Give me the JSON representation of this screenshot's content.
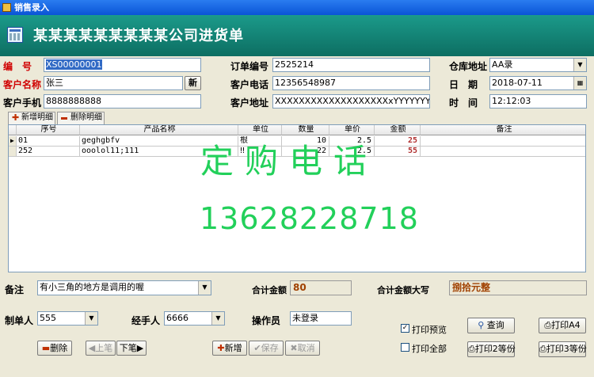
{
  "window": {
    "title": "销售录入"
  },
  "header": {
    "title": "某某某某某某某某某公司进货单"
  },
  "form": {
    "id_label": "编　号",
    "id_value": "XS00000001",
    "order_no_label": "订单编号",
    "order_no_value": "2525214",
    "warehouse_label": "仓库地址",
    "warehouse_value": "AA录",
    "customer_name_label": "客户名称",
    "customer_name_value": "张三",
    "new_customer_label": "新",
    "customer_phone_label": "客户电话",
    "customer_phone_value": "12356548987",
    "date_label": "日　期",
    "date_value": "2018-07-11",
    "customer_mobile_label": "客户手机",
    "customer_mobile_value": "8888888888",
    "customer_address_label": "客户地址",
    "customer_address_value": "XXXXXXXXXXXXXXXXXXXxYYYYYYYY",
    "time_label": "时　间",
    "time_value": "12:12:03"
  },
  "tabs": {
    "add_label": "新增明细",
    "delete_label": "删除明细"
  },
  "grid": {
    "columns": [
      "序号",
      "产品名称",
      "单位",
      "数量",
      "单价",
      "金额",
      "备注"
    ],
    "rows": [
      {
        "seq": "01",
        "name": "geghgbfv",
        "unit": "根",
        "qty": "10",
        "price": "2.5",
        "amount": "25",
        "note": ""
      },
      {
        "seq": "252",
        "name": "ooolol11;111",
        "unit": "‼",
        "qty": "22",
        "price": "2.5",
        "amount": "55",
        "note": ""
      }
    ]
  },
  "watermark": {
    "line1": "定购电话",
    "line2": "13628228718"
  },
  "footer": {
    "remark_label": "备注",
    "remark_value": "有小三角的地方是调用的喔",
    "total_label": "合计金额",
    "total_value": "80",
    "total_upper_label": "合计金额大写",
    "total_upper_value": "捌拾元整",
    "maker_label": "制单人",
    "maker_value": "555",
    "handler_label": "经手人",
    "handler_value": "6666",
    "operator_label": "操作员",
    "operator_value": "未登录",
    "print_preview_label": "打印预览",
    "print_all_label": "打印全部",
    "query_label": "查询",
    "print_a4_label": "打印A4",
    "print_half_label": "打印2等份",
    "print_third_label": "打印3等份",
    "delete_label": "删除",
    "prev_label": "上笔",
    "next_label": "下笔",
    "add_label": "新增",
    "save_label": "保存",
    "cancel_label": "取消"
  }
}
